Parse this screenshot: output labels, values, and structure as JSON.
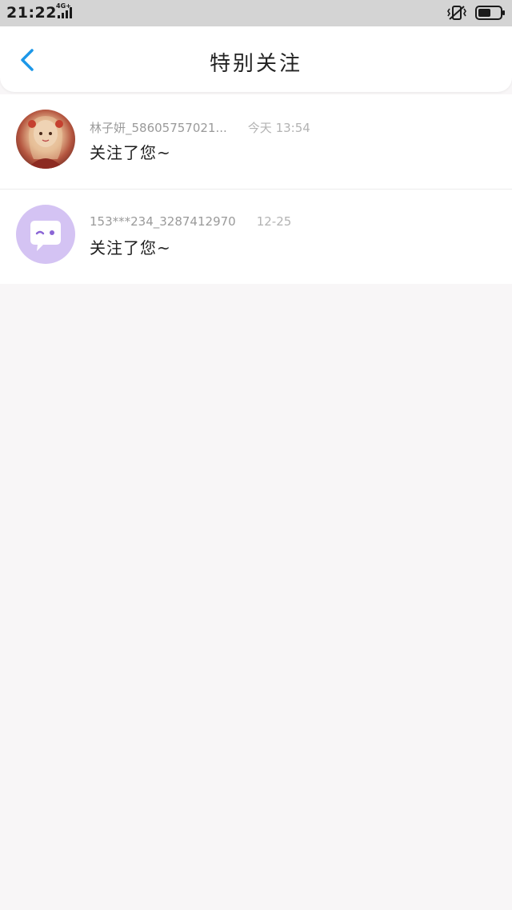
{
  "status_bar": {
    "time": "21:22",
    "network": "4G+"
  },
  "header": {
    "title": "特别关注"
  },
  "colors": {
    "accent": "#1c97e8",
    "avatar_default_bg": "#d4c3f3",
    "avatar_default_icon": "#8b66d6"
  },
  "items": [
    {
      "name": "林子妍_58605757021...",
      "date": "今天 13:54",
      "message": "关注了您~",
      "avatar": "photo-avatar"
    },
    {
      "name": "153***234_3287412970",
      "date": "12-25",
      "message": "关注了您~",
      "avatar": "chat-bubble-icon"
    }
  ]
}
